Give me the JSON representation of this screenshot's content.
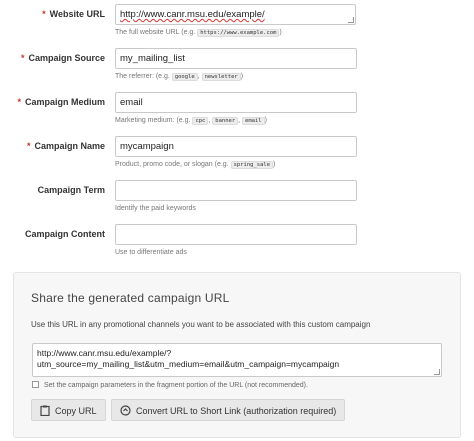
{
  "form": {
    "fields": [
      {
        "label": "Website URL",
        "required": true,
        "value": "http://www.canr.msu.edu/example/",
        "help_prefix": "The full website URL (e.g.",
        "examples": [
          "https://www.example.com"
        ],
        "help_suffix": ")"
      },
      {
        "label": "Campaign Source",
        "required": true,
        "value": "my_mailing_list",
        "help_prefix": "The referrer: (e.g.",
        "examples": [
          "google",
          "newsletter"
        ],
        "help_suffix": ")"
      },
      {
        "label": "Campaign Medium",
        "required": true,
        "value": "email",
        "help_prefix": "Marketing medium: (e.g.",
        "examples": [
          "cpc",
          "banner",
          "email"
        ],
        "help_suffix": ")"
      },
      {
        "label": "Campaign Name",
        "required": true,
        "value": "mycampaign",
        "help_prefix": "Product, promo code, or slogan (e.g.",
        "examples": [
          "spring_sale"
        ],
        "help_suffix": ")"
      },
      {
        "label": "Campaign Term",
        "required": false,
        "value": "",
        "help_prefix": "Identify the paid keywords",
        "examples": [],
        "help_suffix": ""
      },
      {
        "label": "Campaign Content",
        "required": false,
        "value": "",
        "help_prefix": "Use to differentiate ads",
        "examples": [],
        "help_suffix": ""
      }
    ],
    "required_marker": "*"
  },
  "share": {
    "title": "Share the generated campaign URL",
    "description": "Use this URL in any promotional channels you want to be associated with this custom campaign",
    "url_line1": "http://www.canr.msu.edu/example/?",
    "url_line2": "utm_source=my_mailing_list&utm_medium=email&utm_campaign=mycampaign",
    "fragment_label": "Set the campaign parameters in the fragment portion of the URL (not recommended).",
    "fragment_checked": false,
    "copy_label": "Copy URL",
    "shorten_label": "Convert URL to Short Link (authorization required)"
  },
  "icons": {
    "copy": "clipboard-icon",
    "shorten": "link-icon"
  }
}
